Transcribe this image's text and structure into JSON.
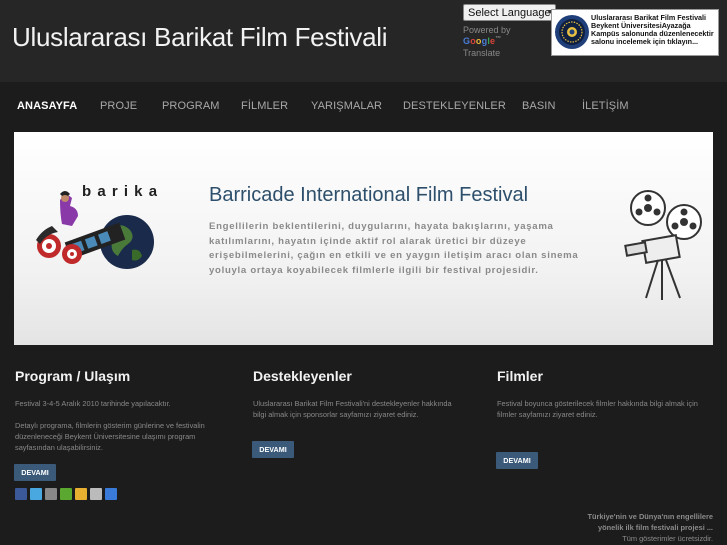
{
  "header": {
    "site_title": "Uluslararası Barikat Film Festivali",
    "language_select": "Select Language",
    "powered_by": "Powered by",
    "google": "Google",
    "translate": "Translate",
    "notice": "Uluslararası Barikat Film Festivali Beykent ÜniversitesiAyazağa Kampüs salonunda düzenlenecektir salonu incelemek için tıklayın..."
  },
  "nav": {
    "items": [
      "ANASAYFA",
      "PROJE",
      "PROGRAM",
      "FİLMLER",
      "YARIŞMALAR",
      "DESTEKLEYENLER",
      "BASIN",
      "İLETİŞİM"
    ]
  },
  "banner": {
    "logo_text": "barikat",
    "heading": "Barricade International Film Festival",
    "text": "Engellilerin beklentilerini, duygularını, hayata bakışlarını, yaşama katılımlarını, hayatın içinde aktif rol alarak üretici bir düzeye erişebilmelerini, çağın en etkili ve en yaygın iletişim aracı olan sinema yoluyla ortaya koyabilecek filmlerle ilgili bir festival projesidir."
  },
  "columns": [
    {
      "title": "Program / Ulaşım",
      "text1": "Festival 3-4-5 Aralık 2010 tarihinde yapılacaktır.",
      "text2": "Detaylı programa, filmlerin gösterim günlerine ve festivalin düzenleneceği Beykent Üniversitesine ulaşımı program sayfasından ulaşabilirsiniz.",
      "button": "DEVAMI"
    },
    {
      "title": "Destekleyenler",
      "text1": "Uluslararası Barikat Film Festivali'ni destekleyenler hakkında bilgi almak için sponsorlar sayfamızı ziyaret ediniz.",
      "button": "DEVAMI"
    },
    {
      "title": "Filmler",
      "text1": "Festival boyunca gösterilecek filmler hakkında bilgi almak için filmler sayfamızı ziyaret ediniz.",
      "button": "DEVAMI"
    }
  ],
  "share_icons": [
    "facebook-icon",
    "twitter-icon",
    "print-icon",
    "share-icon",
    "favorite-icon",
    "email-icon",
    "delicious-icon"
  ],
  "footer": {
    "line1": "Türkiye'nin ve Dünya'nın engellilere",
    "line2": "yönelik ilk film festivali projesi ...",
    "line3": "Tüm gösterimler ücretsizdir."
  },
  "colors": {
    "background": "#1c1c1c",
    "header": "#262626",
    "button": "#3b5a7a",
    "banner_heading": "#2d4f6b"
  }
}
